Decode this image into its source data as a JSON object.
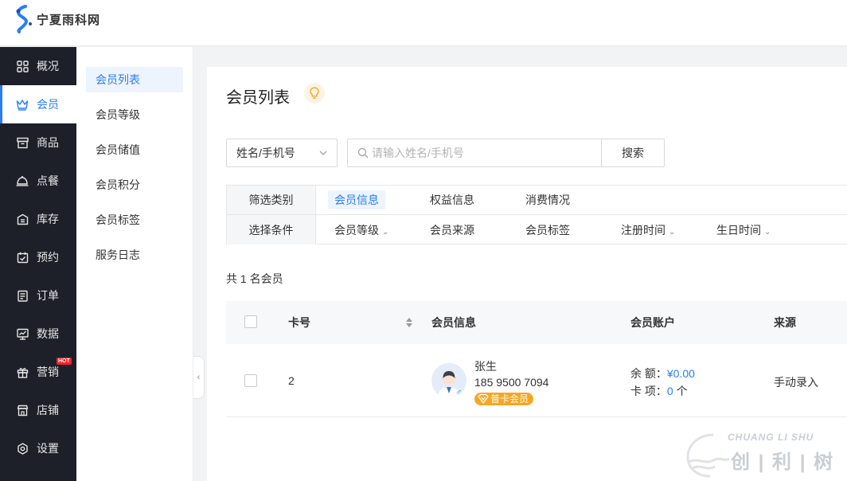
{
  "brand": {
    "name": "宁夏雨科网"
  },
  "sidebar": {
    "items": [
      {
        "label": "概况",
        "icon": "dashboard-icon"
      },
      {
        "label": "会员",
        "icon": "crown-icon"
      },
      {
        "label": "商品",
        "icon": "shop-box-icon"
      },
      {
        "label": "点餐",
        "icon": "food-cover-icon"
      },
      {
        "label": "库存",
        "icon": "inventory-icon"
      },
      {
        "label": "预约",
        "icon": "calendar-check-icon"
      },
      {
        "label": "订单",
        "icon": "order-icon"
      },
      {
        "label": "数据",
        "icon": "monitor-chart-icon"
      },
      {
        "label": "营销",
        "icon": "gift-icon",
        "badge": "HOT"
      },
      {
        "label": "店铺",
        "icon": "store-icon"
      },
      {
        "label": "设置",
        "icon": "settings-icon"
      }
    ],
    "active_index": 1
  },
  "subnav": {
    "items": [
      "会员列表",
      "会员等级",
      "会员储值",
      "会员积分",
      "会员标签",
      "服务日志"
    ],
    "active_index": 0
  },
  "page": {
    "title": "会员列表"
  },
  "search": {
    "select_value": "姓名/手机号",
    "placeholder": "请输入姓名/手机号",
    "button_label": "搜索"
  },
  "filter": {
    "category_label": "筛选类别",
    "categories": [
      "会员信息",
      "权益信息",
      "消费情况"
    ],
    "active_category": 0,
    "condition_label": "选择条件",
    "conditions": [
      {
        "label": "会员等级",
        "dropdown": true
      },
      {
        "label": "会员来源",
        "dropdown": false
      },
      {
        "label": "会员标签",
        "dropdown": false
      },
      {
        "label": "注册时间",
        "dropdown": true
      },
      {
        "label": "生日时间",
        "dropdown": true
      }
    ]
  },
  "summary": {
    "text": "共 1 名会员"
  },
  "table": {
    "headers": {
      "card_no": "卡号",
      "info": "会员信息",
      "account": "会员账户",
      "source": "来源"
    },
    "rows": [
      {
        "card_no": "2",
        "name": "张生",
        "phone": "185 9500 7094",
        "gender": "♂",
        "level": "普卡会员",
        "balance_label": "余 额：",
        "balance": "¥0.00",
        "cards_label": "卡 项：",
        "cards_count": "0",
        "cards_unit": "个",
        "source": "手动录入"
      }
    ]
  },
  "watermark": {
    "latin": "CHUANG LI SHU",
    "cn": "创 | 利 | 树"
  },
  "colors": {
    "accent": "#2a7df6",
    "sidebar_bg": "#1d2029",
    "badge": "#f6a623",
    "hot": "#f5222d"
  }
}
